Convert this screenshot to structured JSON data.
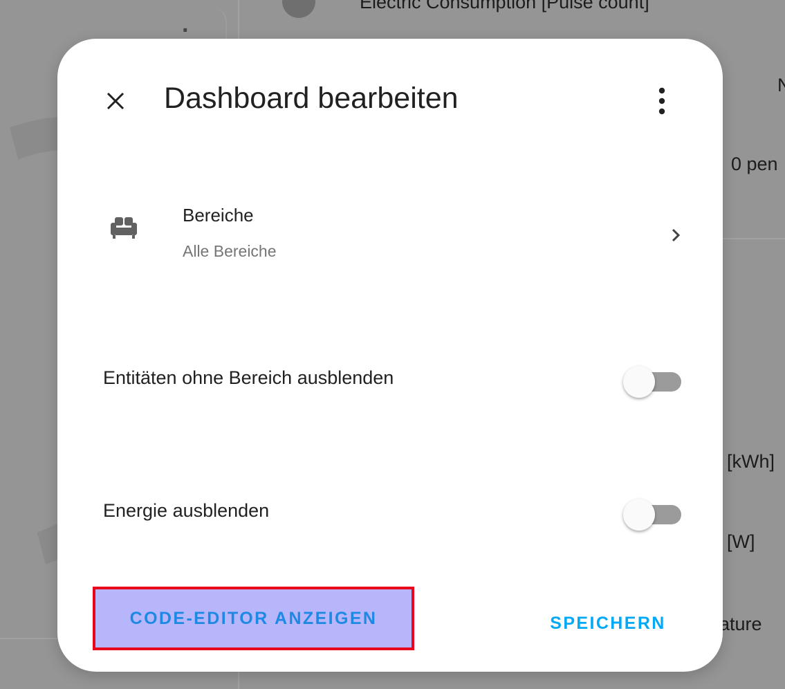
{
  "background": {
    "texts": [
      {
        "id": "electric",
        "text": "Electric Consumption [Pulse count]"
      },
      {
        "id": "n",
        "text": "N"
      },
      {
        "id": "pen",
        "text": "0 pen"
      },
      {
        "id": "kwh",
        "text": "[kWh]"
      },
      {
        "id": "w",
        "text": "[W]"
      },
      {
        "id": "temp",
        "text": "rature"
      }
    ]
  },
  "dialog": {
    "title": "Dashboard bearbeiten",
    "close_icon": "close-icon",
    "menu_icon": "dots-vertical-icon",
    "area": {
      "icon": "sofa-icon",
      "title": "Bereiche",
      "subtitle": "Alle Bereiche",
      "chevron_icon": "chevron-right-icon"
    },
    "toggles": [
      {
        "label": "Entitäten ohne Bereich ausblenden",
        "checked": false
      },
      {
        "label": "Energie ausblenden",
        "checked": false
      }
    ],
    "actions": {
      "code_editor_label": "CODE-EDITOR ANZEIGEN",
      "save_label": "SPEICHERN"
    }
  },
  "colors": {
    "primary": "#03a9f4",
    "highlight_fill": "#b7b6fb",
    "highlight_border": "#e8051b",
    "scrim": "#959595"
  }
}
